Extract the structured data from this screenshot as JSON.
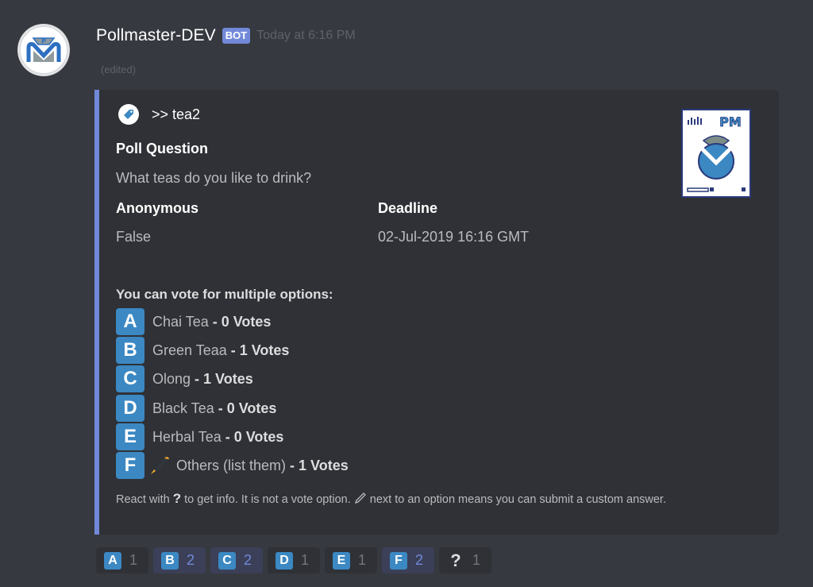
{
  "message": {
    "username": "Pollmaster-DEV",
    "bot_tag": "BOT",
    "timestamp": "Today at 6:16 PM",
    "edited": "(edited)"
  },
  "embed": {
    "accent_color": "#7289da",
    "author": ">> tea2",
    "thumbnail_text": "PM",
    "fields": [
      {
        "name": "Poll Question",
        "value": "What teas do you like to drink?"
      },
      {
        "name": "Anonymous",
        "value": "False"
      },
      {
        "name": "Deadline",
        "value": "02-Jul-2019 16:16 GMT"
      }
    ],
    "options_title": "You can vote for multiple options:",
    "options": [
      {
        "letter": "A",
        "label": "Chai Tea",
        "votes": "- 0 Votes",
        "custom": false
      },
      {
        "letter": "B",
        "label": "Green Teaa",
        "votes": "- 1 Votes",
        "custom": false
      },
      {
        "letter": "C",
        "label": "Olong",
        "votes": "- 1 Votes",
        "custom": false
      },
      {
        "letter": "D",
        "label": "Black Tea",
        "votes": "- 0 Votes",
        "custom": false
      },
      {
        "letter": "E",
        "label": "Herbal Tea",
        "votes": "- 0 Votes",
        "custom": false
      },
      {
        "letter": "F",
        "label": "Others (list them)",
        "votes": "- 1 Votes",
        "custom": true
      }
    ],
    "footer": {
      "part1": "React with",
      "q_icon": "?",
      "part2": "to get info. It is not a vote option.",
      "part3": "next to an option means you can submit a custom answer."
    }
  },
  "reactions": [
    {
      "emoji": "A",
      "count": "1",
      "me": false
    },
    {
      "emoji": "B",
      "count": "2",
      "me": true
    },
    {
      "emoji": "C",
      "count": "2",
      "me": true
    },
    {
      "emoji": "D",
      "count": "1",
      "me": false
    },
    {
      "emoji": "E",
      "count": "1",
      "me": false
    },
    {
      "emoji": "F",
      "count": "2",
      "me": true
    },
    {
      "emoji": "?",
      "count": "1",
      "me": false
    }
  ]
}
